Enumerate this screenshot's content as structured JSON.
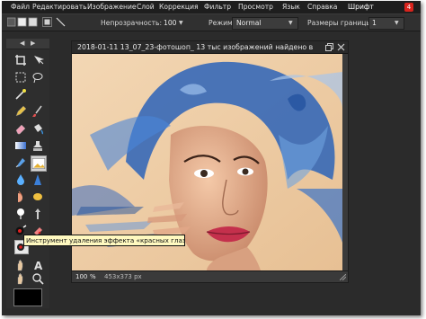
{
  "menubar": {
    "items": [
      "Файл",
      "Редактировать",
      "Изображение",
      "Слой",
      "Коррекция",
      "Фильтр",
      "Просмотр",
      "Язык",
      "Справка",
      "Шрифт"
    ],
    "badge": "4"
  },
  "options": {
    "opacity_label": "Непрозрачность:",
    "opacity_value": "100",
    "mode_label": "Режим:",
    "mode_value": "Normal",
    "border_label": "Размеры границы:",
    "border_value": "1"
  },
  "document": {
    "title": "2018-01-11 13_07_23-фотошоп_ 13 тыс изображений найдено в",
    "zoom": "100",
    "zoom_unit": "%",
    "size": "453x373 px"
  },
  "tooltip": "Инструмент удаления эффекта «красных глаз»",
  "colors": {
    "foreground": "#000000",
    "background": "#ffffff",
    "chrome": "#2b2b2b",
    "menubar": "#1e1e1e",
    "accent": "#d8231c"
  }
}
